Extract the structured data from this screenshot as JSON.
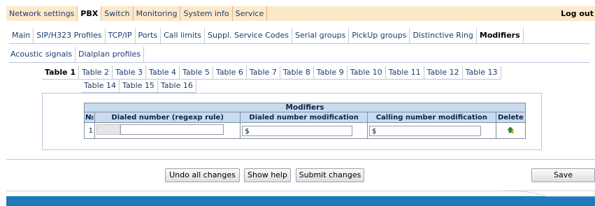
{
  "top_menu": {
    "items": [
      "Network settings",
      "PBX",
      "Switch",
      "Monitoring",
      "System info",
      "Service"
    ],
    "active": "PBX",
    "logout": "Log out"
  },
  "sub_tabs": {
    "row1": [
      "Main",
      "SIP/H323 Profiles",
      "TCP/IP",
      "Ports",
      "Call limits",
      "Suppl. Service Codes",
      "Serial groups",
      "PickUp groups",
      "Distinctive Ring",
      "Modifiers"
    ],
    "row2": [
      "Acoustic signals",
      "Dialplan profiles"
    ],
    "active": "Modifiers"
  },
  "table_tabs": {
    "row1": [
      "Table 1",
      "Table 2",
      "Table 3",
      "Table 4",
      "Table 5",
      "Table 6",
      "Table 7",
      "Table 8",
      "Table 9",
      "Table 10",
      "Table 11",
      "Table 12",
      "Table 13"
    ],
    "row2": [
      "Table 14",
      "Table 15",
      "Table 16"
    ],
    "active": "Table 1"
  },
  "modifiers_table": {
    "caption": "Modifiers",
    "headers": [
      "№",
      "Dialed number (regexp rule)",
      "Dialed number modification",
      "Calling number modification",
      "Delete"
    ],
    "rows": [
      {
        "index": "1",
        "dialed_rule": "",
        "dialed_mod": "$",
        "calling_mod": "$",
        "delete_icon": "delete-icon"
      }
    ]
  },
  "buttons": {
    "undo": "Undo all changes",
    "help": "Show help",
    "submit": "Submit changes",
    "save": "Save"
  },
  "colors": {
    "top_menu_bg": "#fde9c8",
    "header_bg": "#c9dbee",
    "footer_bg": "#1e7ab8"
  }
}
